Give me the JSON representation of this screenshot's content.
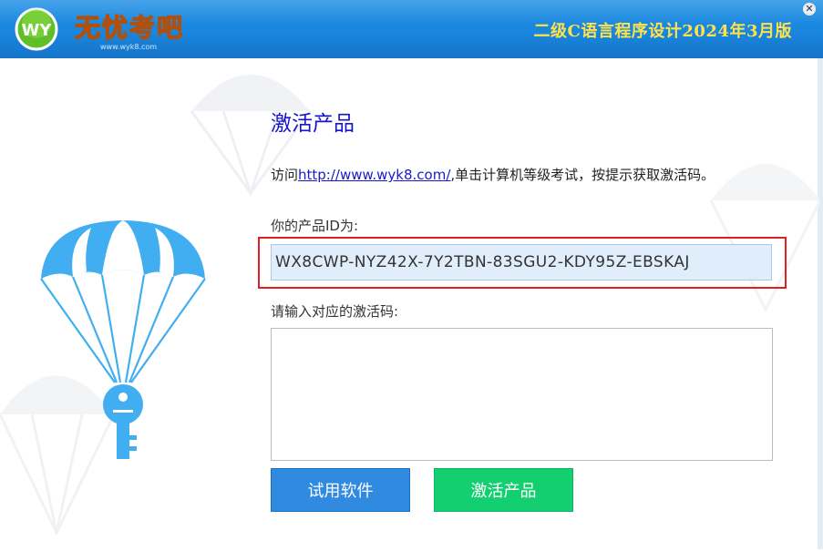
{
  "header": {
    "logo_text": "无忧考吧",
    "logo_badge": "WY",
    "logo_url_text": "www.wyk8.com",
    "title": "二级C语言程序设计2024年3月版",
    "close_glyph": "✕"
  },
  "main": {
    "page_title": "激活产品",
    "instruction_prefix": "访问",
    "instruction_link": "http://www.wyk8.com/",
    "instruction_suffix": ",单击计算机等级考试，按提示获取激活码。",
    "product_id_label": "你的产品ID为:",
    "product_id_value": "WX8CWP-NYZ42X-7Y2TBN-83SGU2-KDY95Z-EBSKAJ",
    "activation_label": "请输入对应的激活码:",
    "activation_value": "",
    "trial_button": "试用软件",
    "activate_button": "激活产品"
  },
  "colors": {
    "header_blue": "#1a86de",
    "title_yellow": "#ffe14a",
    "page_title_blue": "#1616c8",
    "trial_button": "#2f8ae0",
    "activate_button": "#13cf6f",
    "highlight_red": "#e02020"
  },
  "icons": [
    "parachute-key-icon",
    "close-icon",
    "logo-badge-icon"
  ]
}
